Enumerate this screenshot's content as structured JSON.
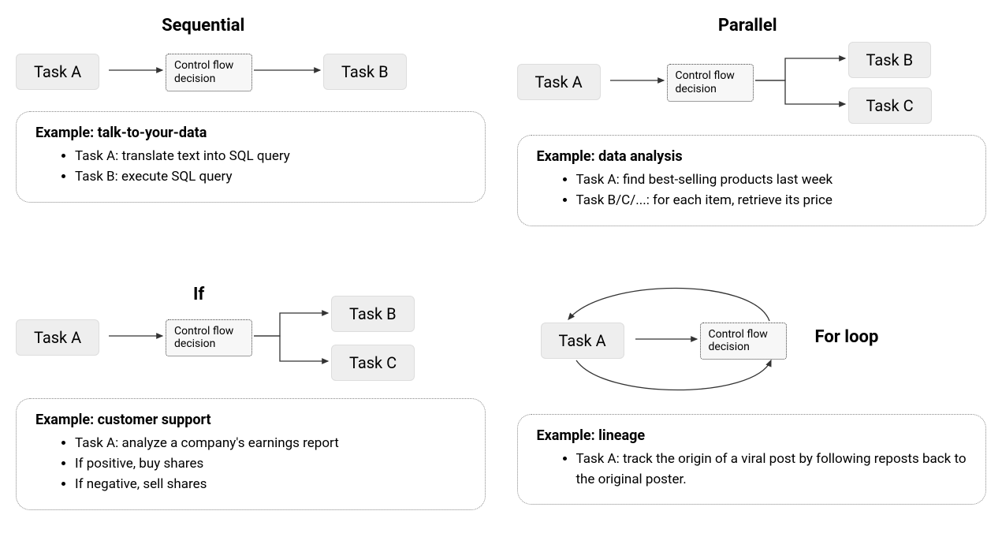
{
  "common": {
    "control_flow_label": "Control flow\ndecision",
    "task_a": "Task A",
    "task_b": "Task B",
    "task_c": "Task C"
  },
  "sequential": {
    "title": "Sequential",
    "example": {
      "heading_prefix": "Example: ",
      "heading": "talk-to-your-data",
      "bullets": [
        "Task A: translate text into SQL query",
        "Task B: execute SQL query"
      ]
    }
  },
  "parallel": {
    "title": "Parallel",
    "example": {
      "heading_prefix": "Example: ",
      "heading": "data analysis",
      "bullets": [
        "Task A:  find best-selling products last week",
        "Task B/C/...: for each item, retrieve its price"
      ]
    }
  },
  "if_branch": {
    "title": "If",
    "example": {
      "heading_prefix": "Example: ",
      "heading": "customer support",
      "bullets": [
        "Task A: analyze a company's earnings report",
        "If positive, buy shares",
        "If negative, sell shares"
      ]
    }
  },
  "for_loop": {
    "title": "For loop",
    "example": {
      "heading_prefix": "Example: ",
      "heading": "lineage",
      "bullets": [
        "Task A:  track the origin of a viral post by following reposts back to the original poster."
      ]
    }
  }
}
